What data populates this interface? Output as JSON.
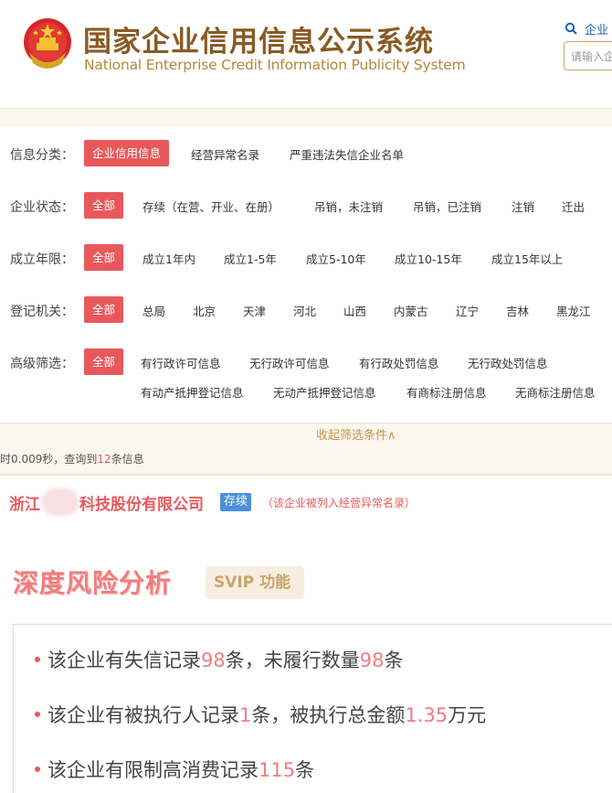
{
  "header": {
    "title_cn": "国家企业信用信息公示系统",
    "title_en": "National Enterprise Credit Information Publicity System",
    "search_link": "企业",
    "search_placeholder": "请输入企"
  },
  "filters": {
    "rows": [
      {
        "label": "信息分类：",
        "active": "企业信用信息",
        "options": [
          "经营异常名录",
          "严重违法失信企业名单"
        ]
      },
      {
        "label": "企业状态：",
        "active": "全部",
        "options": [
          "存续（在营、开业、在册）",
          "吊销，未注销",
          "吊销，已注销",
          "注销",
          "迁出"
        ]
      },
      {
        "label": "成立年限：",
        "active": "全部",
        "options": [
          "成立1年内",
          "成立1-5年",
          "成立5-10年",
          "成立10-15年",
          "成立15年以上"
        ]
      },
      {
        "label": "登记机关：",
        "active": "全部",
        "options": [
          "总局",
          "北京",
          "天津",
          "河北",
          "山西",
          "内蒙古",
          "辽宁",
          "吉林",
          "黑龙江"
        ]
      },
      {
        "label": "高级筛选：",
        "active": "全部",
        "options": [
          "有行政许可信息",
          "无行政许可信息",
          "有行政处罚信息",
          "无行政处罚信息",
          "有动产抵押登记信息",
          "无动产抵押登记信息",
          "有商标注册信息",
          "无商标注册信息"
        ]
      }
    ],
    "collapse_label": "收起筛选条件∧"
  },
  "summary": {
    "prefix": "时0.009秒，查询到",
    "count": "12",
    "suffix": "条信息"
  },
  "company": {
    "name_start": "浙江",
    "name_end": "科技股份有限公司",
    "status": "存续",
    "note": "（该企业被列入经营异常名录）"
  },
  "risk": {
    "title": "深度风险分析",
    "badge": "SVIP 功能",
    "items": [
      {
        "a": "该企业有失信记录",
        "n1": "98",
        "b": "条，未履行数量",
        "n2": "98",
        "c": "条"
      },
      {
        "a": "该企业有被执行人记录",
        "n1": "1",
        "b": "条，被执行总金额",
        "n2": "1.35",
        "c": "万元"
      },
      {
        "a": "该企业有限制高消费记录",
        "n1": "115",
        "b": "条",
        "n2": "",
        "c": ""
      }
    ]
  },
  "colors": {
    "brand_gold": "#8a5a24",
    "accent_red": "#e8585b",
    "status_blue": "#4a90d9"
  }
}
